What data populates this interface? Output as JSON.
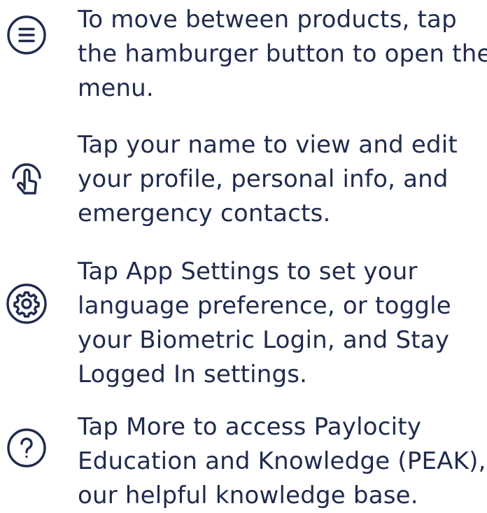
{
  "colors": {
    "text": "#1f2a4d",
    "icon_stroke": "#1f2a4d",
    "background": "#ffffff"
  },
  "tips": [
    {
      "icon": "hamburger-menu-icon",
      "lines": [
        "To move between products, tap",
        "the hamburger button to open the",
        "menu."
      ]
    },
    {
      "icon": "tap-hand-icon",
      "lines": [
        "Tap your name to view and edit",
        "your profile, personal info, and",
        "emergency contacts."
      ]
    },
    {
      "icon": "gear-icon",
      "lines": [
        "Tap App Settings to set your",
        "language preference, or toggle",
        "your Biometric Login, and Stay",
        "Logged In settings."
      ]
    },
    {
      "icon": "question-circle-icon",
      "lines": [
        "Tap More to access Paylocity",
        "Education and Knowledge (PEAK),",
        "our helpful knowledge base."
      ]
    }
  ]
}
